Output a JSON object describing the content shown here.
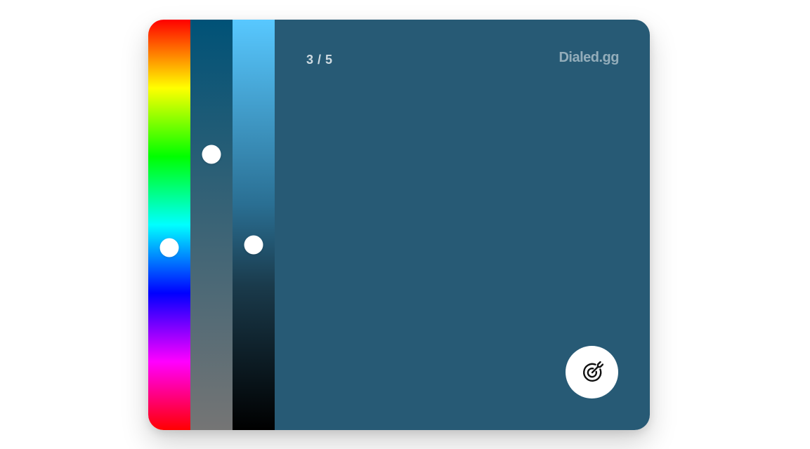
{
  "counter": {
    "current": 3,
    "total": 5,
    "label": "3 / 5"
  },
  "brand": {
    "name": "Dialed.gg"
  },
  "sliders": {
    "hue": {
      "value_fraction": 0.555
    },
    "saturation": {
      "value_fraction": 0.328
    },
    "lightness": {
      "value_fraction": 0.549
    }
  },
  "colors": {
    "preview": "#275a75",
    "action_button": "#ffffff",
    "icon": "#111111"
  },
  "action": {
    "icon": "target-submit-icon"
  }
}
